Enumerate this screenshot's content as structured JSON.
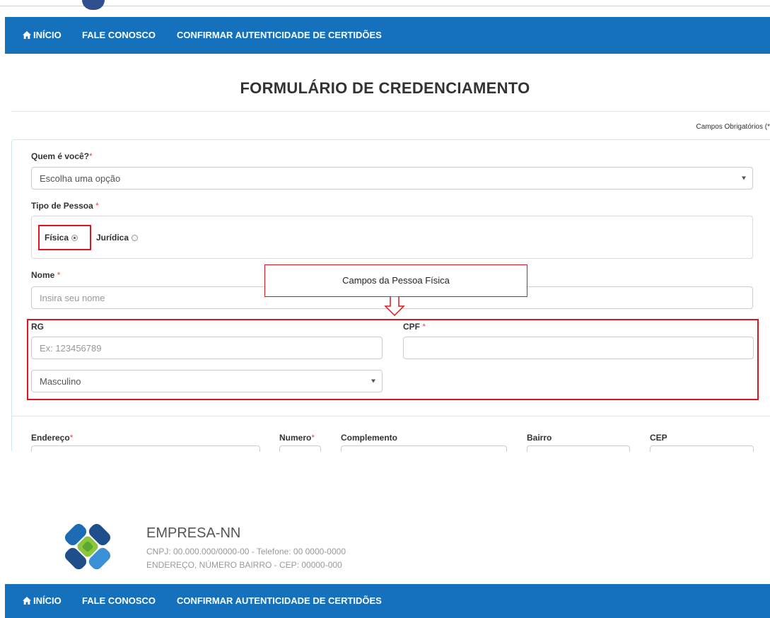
{
  "nav": {
    "home": "INÍCIO",
    "contact": "FALE CONOSCO",
    "verify": "CONFIRMAR AUTENTICIDADE DE CERTIDÕES"
  },
  "page_title": "FORMULÁRIO DE CREDENCIAMENTO",
  "required_note": "Campos Obrigatórios (*",
  "form": {
    "quem_label": "Quem é você?",
    "quem_select_value": "Escolha uma opção",
    "tipo_label": "Tipo de Pessoa ",
    "fisica_label": "Física",
    "juridica_label": "Jurídica",
    "nome_label": "Nome ",
    "nome_placeholder": "Insira seu nome",
    "rg_label": "RG",
    "rg_placeholder": "Ex: 123456789",
    "cpf_label": "CPF ",
    "sexo_select_value": "Masculino",
    "endereco_label": "Endereço",
    "numero_label": "Numero",
    "complemento_label": "Complemento",
    "bairro_label": "Bairro",
    "cep_label": "CEP",
    "required_mark": "*"
  },
  "annotation": {
    "callout_text": "Campos da Pessoa Física"
  },
  "footer": {
    "company_name": "EMPRESA-NN",
    "cnpj_line": "CNPJ: 00.000.000/0000-00 - Telefone: 00 0000-0000",
    "address_line": "ENDEREÇO, NÚMERO BAIRRO - CEP: 00000-000"
  },
  "colors": {
    "navbar": "#1671bd",
    "required": "#d9534f",
    "annotation": "#e0141b"
  }
}
